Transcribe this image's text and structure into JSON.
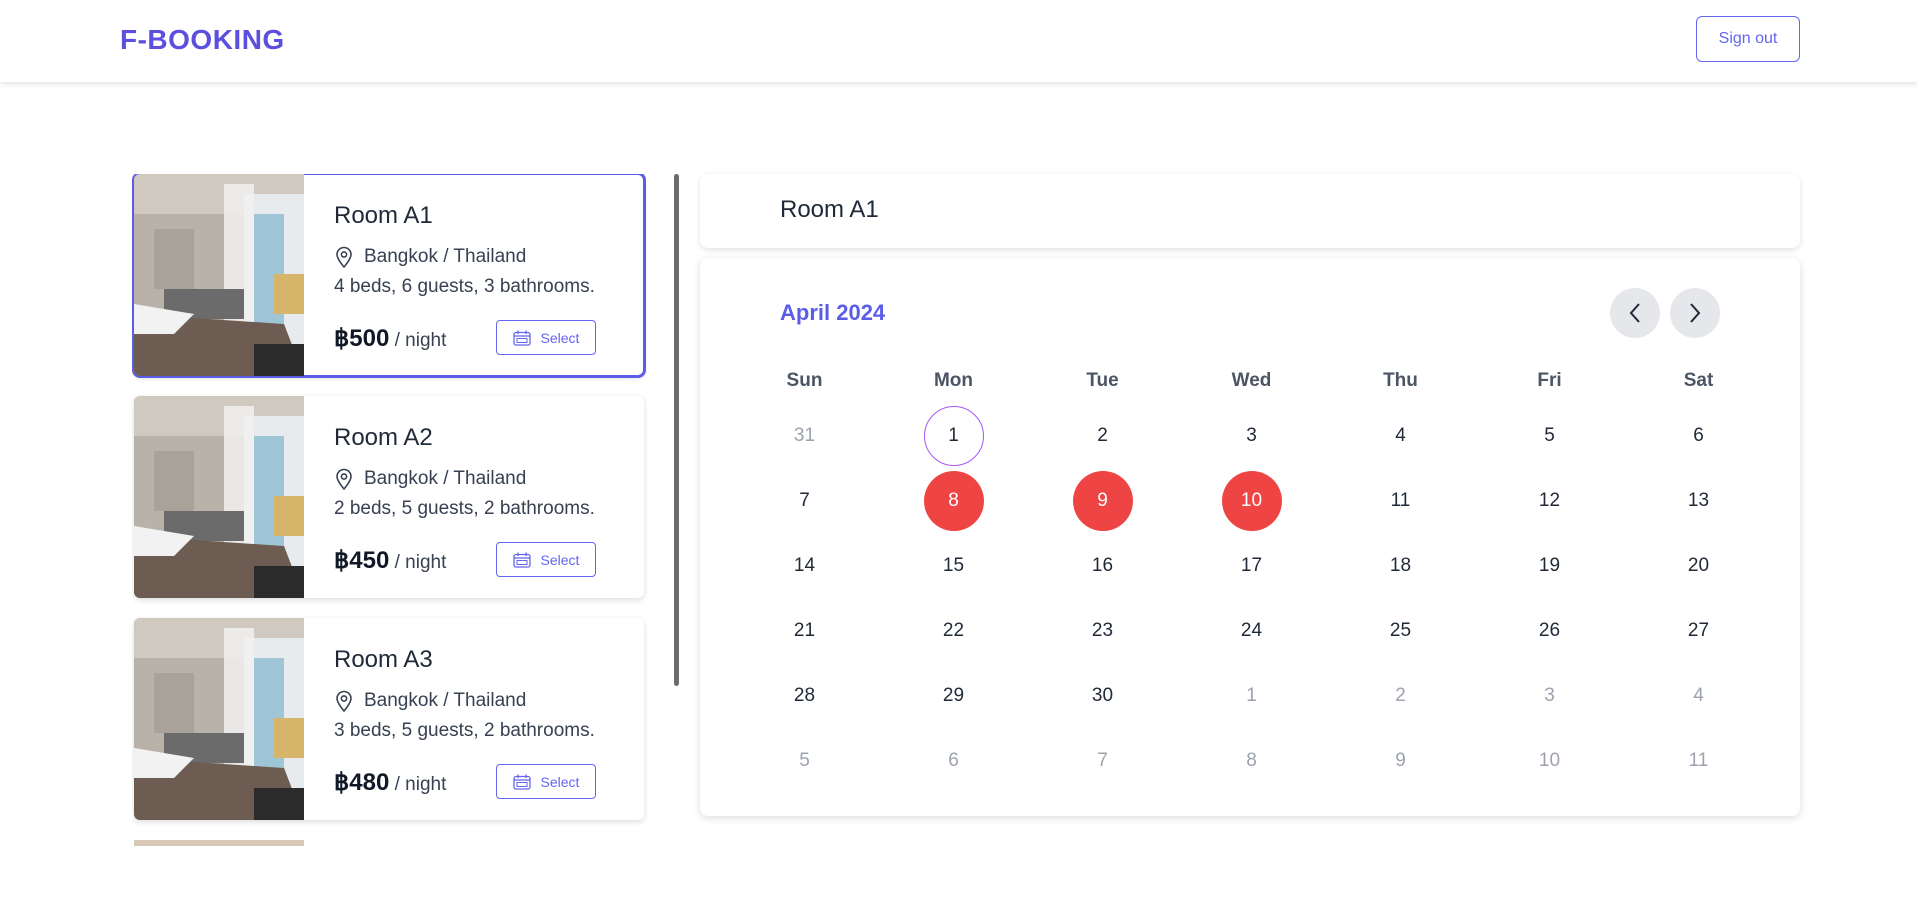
{
  "header": {
    "brand": "F-BOOKING",
    "signout_label": "Sign out"
  },
  "rooms": [
    {
      "name": "Room A1",
      "location": "Bangkok / Thailand",
      "details": "4 beds, 6 guests, 3 bathrooms.",
      "price": "฿500",
      "unit": "/ night",
      "select_label": "Select",
      "selected": true
    },
    {
      "name": "Room A2",
      "location": "Bangkok / Thailand",
      "details": "2 beds, 5 guests, 2 bathrooms.",
      "price": "฿450",
      "unit": "/ night",
      "select_label": "Select",
      "selected": false
    },
    {
      "name": "Room A3",
      "location": "Bangkok / Thailand",
      "details": "3 beds, 5 guests, 2 bathrooms.",
      "price": "฿480",
      "unit": "/ night",
      "select_label": "Select",
      "selected": false
    }
  ],
  "calendar": {
    "room_title": "Room A1",
    "month_label": "April 2024",
    "weekdays": [
      "Sun",
      "Mon",
      "Tue",
      "Wed",
      "Thu",
      "Fri",
      "Sat"
    ],
    "weeks": [
      [
        {
          "d": "31",
          "m": true
        },
        {
          "d": "1",
          "today": true
        },
        {
          "d": "2"
        },
        {
          "d": "3"
        },
        {
          "d": "4"
        },
        {
          "d": "5"
        },
        {
          "d": "6"
        }
      ],
      [
        {
          "d": "7"
        },
        {
          "d": "8",
          "booked": true
        },
        {
          "d": "9",
          "booked": true
        },
        {
          "d": "10",
          "booked": true
        },
        {
          "d": "11"
        },
        {
          "d": "12"
        },
        {
          "d": "13"
        }
      ],
      [
        {
          "d": "14"
        },
        {
          "d": "15"
        },
        {
          "d": "16"
        },
        {
          "d": "17"
        },
        {
          "d": "18"
        },
        {
          "d": "19"
        },
        {
          "d": "20"
        }
      ],
      [
        {
          "d": "21"
        },
        {
          "d": "22"
        },
        {
          "d": "23"
        },
        {
          "d": "24"
        },
        {
          "d": "25"
        },
        {
          "d": "26"
        },
        {
          "d": "27"
        }
      ],
      [
        {
          "d": "28"
        },
        {
          "d": "29"
        },
        {
          "d": "30"
        },
        {
          "d": "1",
          "m": true
        },
        {
          "d": "2",
          "m": true
        },
        {
          "d": "3",
          "m": true
        },
        {
          "d": "4",
          "m": true
        }
      ],
      [
        {
          "d": "5",
          "m": true
        },
        {
          "d": "6",
          "m": true
        },
        {
          "d": "7",
          "m": true
        },
        {
          "d": "8",
          "m": true
        },
        {
          "d": "9",
          "m": true
        },
        {
          "d": "10",
          "m": true
        },
        {
          "d": "11",
          "m": true
        }
      ]
    ]
  },
  "colors": {
    "accent": "#5b5ce8",
    "booked": "#ef4444",
    "today_ring": "#a855f7",
    "muted": "#9ca3af"
  },
  "icons": {
    "location": "map-pin-icon",
    "select": "calendar-icon",
    "prev": "chevron-left-icon",
    "next": "chevron-right-icon"
  }
}
